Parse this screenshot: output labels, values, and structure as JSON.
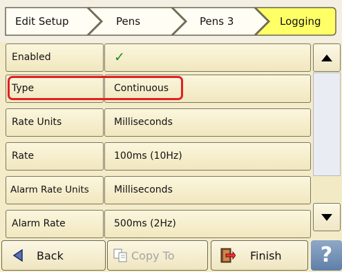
{
  "breadcrumb": {
    "items": [
      {
        "label": "Edit Setup"
      },
      {
        "label": "Pens"
      },
      {
        "label": "Pens 3"
      },
      {
        "label": "Logging"
      }
    ]
  },
  "rows": [
    {
      "label": "Enabled",
      "value": "✓",
      "value_is_check": true
    },
    {
      "label": "Type",
      "value": "Continuous",
      "highlighted": true
    },
    {
      "label": "Rate Units",
      "value": "Milliseconds"
    },
    {
      "label": "Rate",
      "value": "100ms (10Hz)"
    },
    {
      "label": "Alarm Rate Units",
      "value": "Milliseconds"
    },
    {
      "label": "Alarm Rate",
      "value": "500ms (2Hz)"
    }
  ],
  "toolbar": {
    "back_label": "Back",
    "copy_to_label": "Copy To",
    "finish_label": "Finish",
    "help_label": "?"
  },
  "colors": {
    "active_crumb": "#ffff66",
    "highlight_outline": "#e02020",
    "check": "#1e8a1e"
  },
  "icons": {
    "back": "triangle-left-icon",
    "copy_to": "copy-pages-icon",
    "finish": "exit-door-icon",
    "help": "question-mark-icon",
    "scroll_up": "triangle-up-icon",
    "scroll_down": "triangle-down-icon"
  }
}
